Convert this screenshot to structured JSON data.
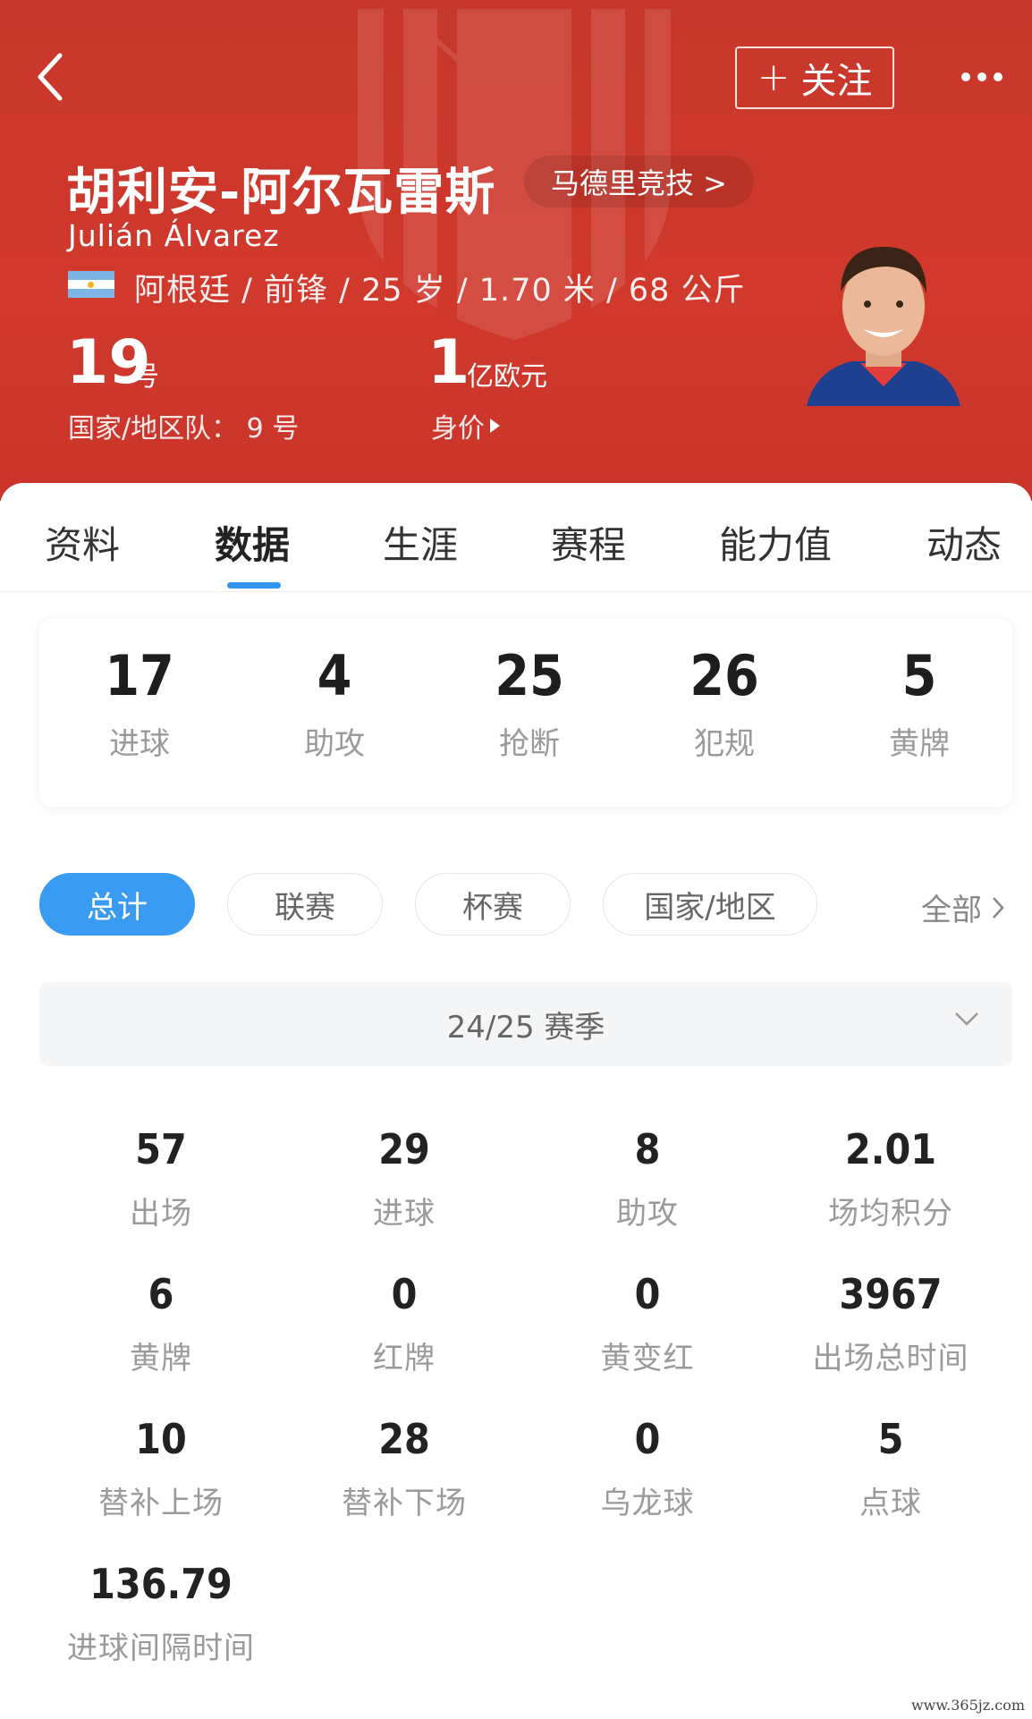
{
  "header": {
    "follow_label": "关注",
    "player_name_cn": "胡利安-阿尔瓦雷斯",
    "player_name_en": "Julián Álvarez",
    "club_label": "马德里竞技 >",
    "info_line": "阿根廷 / 前锋 / 25 岁 / 1.70 米 / 68 公斤",
    "shirt_number": "19",
    "shirt_number_unit": "号",
    "national_team_number": "国家/地区队： 9 号",
    "market_value": "1",
    "market_value_unit": "亿欧元",
    "market_value_label": "身价",
    "colors": {
      "bg": "#cd382b",
      "accent": "#2f95f0"
    }
  },
  "tabs": [
    {
      "label": "资料"
    },
    {
      "label": "数据",
      "active": true
    },
    {
      "label": "生涯"
    },
    {
      "label": "赛程"
    },
    {
      "label": "能力值"
    },
    {
      "label": "动态"
    }
  ],
  "summary": [
    {
      "value": "17",
      "label": "进球"
    },
    {
      "value": "4",
      "label": "助攻"
    },
    {
      "value": "25",
      "label": "抢断"
    },
    {
      "value": "26",
      "label": "犯规"
    },
    {
      "value": "5",
      "label": "黄牌"
    }
  ],
  "filters": [
    {
      "label": "总计",
      "active": true
    },
    {
      "label": "联赛"
    },
    {
      "label": "杯赛"
    },
    {
      "label": "国家/地区"
    }
  ],
  "all_label": "全部",
  "season_label": "24/25 赛季",
  "stats": [
    {
      "value": "57",
      "label": "出场"
    },
    {
      "value": "29",
      "label": "进球"
    },
    {
      "value": "8",
      "label": "助攻"
    },
    {
      "value": "2.01",
      "label": "场均积分"
    },
    {
      "value": "6",
      "label": "黄牌"
    },
    {
      "value": "0",
      "label": "红牌"
    },
    {
      "value": "0",
      "label": "黄变红"
    },
    {
      "value": "3967",
      "label": "出场总时间"
    },
    {
      "value": "10",
      "label": "替补上场"
    },
    {
      "value": "28",
      "label": "替补下场"
    },
    {
      "value": "0",
      "label": "乌龙球"
    },
    {
      "value": "5",
      "label": "点球"
    },
    {
      "value": "136.79",
      "label": "进球间隔时间"
    }
  ],
  "watermark": "www.365jz.com",
  "icons": [
    "back-arrow-icon",
    "more-dots-icon",
    "argentina-flag-icon",
    "chevron-right-icon",
    "chevron-down-icon"
  ]
}
